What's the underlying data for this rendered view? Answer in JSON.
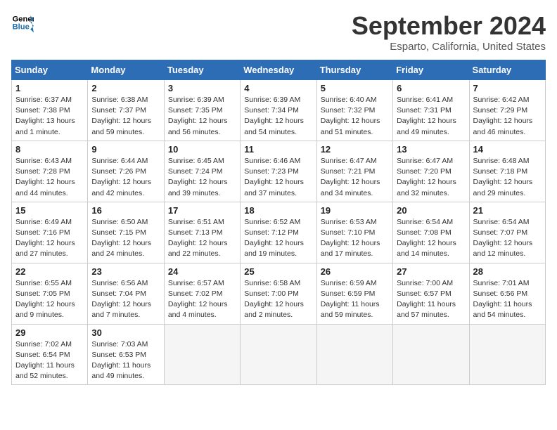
{
  "logo": {
    "line1": "General",
    "line2": "Blue"
  },
  "title": "September 2024",
  "subtitle": "Esparto, California, United States",
  "days_of_week": [
    "Sunday",
    "Monday",
    "Tuesday",
    "Wednesday",
    "Thursday",
    "Friday",
    "Saturday"
  ],
  "weeks": [
    [
      {
        "day": "1",
        "sunrise": "Sunrise: 6:37 AM",
        "sunset": "Sunset: 7:38 PM",
        "daylight": "Daylight: 13 hours and 1 minute."
      },
      {
        "day": "2",
        "sunrise": "Sunrise: 6:38 AM",
        "sunset": "Sunset: 7:37 PM",
        "daylight": "Daylight: 12 hours and 59 minutes."
      },
      {
        "day": "3",
        "sunrise": "Sunrise: 6:39 AM",
        "sunset": "Sunset: 7:35 PM",
        "daylight": "Daylight: 12 hours and 56 minutes."
      },
      {
        "day": "4",
        "sunrise": "Sunrise: 6:39 AM",
        "sunset": "Sunset: 7:34 PM",
        "daylight": "Daylight: 12 hours and 54 minutes."
      },
      {
        "day": "5",
        "sunrise": "Sunrise: 6:40 AM",
        "sunset": "Sunset: 7:32 PM",
        "daylight": "Daylight: 12 hours and 51 minutes."
      },
      {
        "day": "6",
        "sunrise": "Sunrise: 6:41 AM",
        "sunset": "Sunset: 7:31 PM",
        "daylight": "Daylight: 12 hours and 49 minutes."
      },
      {
        "day": "7",
        "sunrise": "Sunrise: 6:42 AM",
        "sunset": "Sunset: 7:29 PM",
        "daylight": "Daylight: 12 hours and 46 minutes."
      }
    ],
    [
      {
        "day": "8",
        "sunrise": "Sunrise: 6:43 AM",
        "sunset": "Sunset: 7:28 PM",
        "daylight": "Daylight: 12 hours and 44 minutes."
      },
      {
        "day": "9",
        "sunrise": "Sunrise: 6:44 AM",
        "sunset": "Sunset: 7:26 PM",
        "daylight": "Daylight: 12 hours and 42 minutes."
      },
      {
        "day": "10",
        "sunrise": "Sunrise: 6:45 AM",
        "sunset": "Sunset: 7:24 PM",
        "daylight": "Daylight: 12 hours and 39 minutes."
      },
      {
        "day": "11",
        "sunrise": "Sunrise: 6:46 AM",
        "sunset": "Sunset: 7:23 PM",
        "daylight": "Daylight: 12 hours and 37 minutes."
      },
      {
        "day": "12",
        "sunrise": "Sunrise: 6:47 AM",
        "sunset": "Sunset: 7:21 PM",
        "daylight": "Daylight: 12 hours and 34 minutes."
      },
      {
        "day": "13",
        "sunrise": "Sunrise: 6:47 AM",
        "sunset": "Sunset: 7:20 PM",
        "daylight": "Daylight: 12 hours and 32 minutes."
      },
      {
        "day": "14",
        "sunrise": "Sunrise: 6:48 AM",
        "sunset": "Sunset: 7:18 PM",
        "daylight": "Daylight: 12 hours and 29 minutes."
      }
    ],
    [
      {
        "day": "15",
        "sunrise": "Sunrise: 6:49 AM",
        "sunset": "Sunset: 7:16 PM",
        "daylight": "Daylight: 12 hours and 27 minutes."
      },
      {
        "day": "16",
        "sunrise": "Sunrise: 6:50 AM",
        "sunset": "Sunset: 7:15 PM",
        "daylight": "Daylight: 12 hours and 24 minutes."
      },
      {
        "day": "17",
        "sunrise": "Sunrise: 6:51 AM",
        "sunset": "Sunset: 7:13 PM",
        "daylight": "Daylight: 12 hours and 22 minutes."
      },
      {
        "day": "18",
        "sunrise": "Sunrise: 6:52 AM",
        "sunset": "Sunset: 7:12 PM",
        "daylight": "Daylight: 12 hours and 19 minutes."
      },
      {
        "day": "19",
        "sunrise": "Sunrise: 6:53 AM",
        "sunset": "Sunset: 7:10 PM",
        "daylight": "Daylight: 12 hours and 17 minutes."
      },
      {
        "day": "20",
        "sunrise": "Sunrise: 6:54 AM",
        "sunset": "Sunset: 7:08 PM",
        "daylight": "Daylight: 12 hours and 14 minutes."
      },
      {
        "day": "21",
        "sunrise": "Sunrise: 6:54 AM",
        "sunset": "Sunset: 7:07 PM",
        "daylight": "Daylight: 12 hours and 12 minutes."
      }
    ],
    [
      {
        "day": "22",
        "sunrise": "Sunrise: 6:55 AM",
        "sunset": "Sunset: 7:05 PM",
        "daylight": "Daylight: 12 hours and 9 minutes."
      },
      {
        "day": "23",
        "sunrise": "Sunrise: 6:56 AM",
        "sunset": "Sunset: 7:04 PM",
        "daylight": "Daylight: 12 hours and 7 minutes."
      },
      {
        "day": "24",
        "sunrise": "Sunrise: 6:57 AM",
        "sunset": "Sunset: 7:02 PM",
        "daylight": "Daylight: 12 hours and 4 minutes."
      },
      {
        "day": "25",
        "sunrise": "Sunrise: 6:58 AM",
        "sunset": "Sunset: 7:00 PM",
        "daylight": "Daylight: 12 hours and 2 minutes."
      },
      {
        "day": "26",
        "sunrise": "Sunrise: 6:59 AM",
        "sunset": "Sunset: 6:59 PM",
        "daylight": "Daylight: 11 hours and 59 minutes."
      },
      {
        "day": "27",
        "sunrise": "Sunrise: 7:00 AM",
        "sunset": "Sunset: 6:57 PM",
        "daylight": "Daylight: 11 hours and 57 minutes."
      },
      {
        "day": "28",
        "sunrise": "Sunrise: 7:01 AM",
        "sunset": "Sunset: 6:56 PM",
        "daylight": "Daylight: 11 hours and 54 minutes."
      }
    ],
    [
      {
        "day": "29",
        "sunrise": "Sunrise: 7:02 AM",
        "sunset": "Sunset: 6:54 PM",
        "daylight": "Daylight: 11 hours and 52 minutes."
      },
      {
        "day": "30",
        "sunrise": "Sunrise: 7:03 AM",
        "sunset": "Sunset: 6:53 PM",
        "daylight": "Daylight: 11 hours and 49 minutes."
      },
      null,
      null,
      null,
      null,
      null
    ]
  ]
}
